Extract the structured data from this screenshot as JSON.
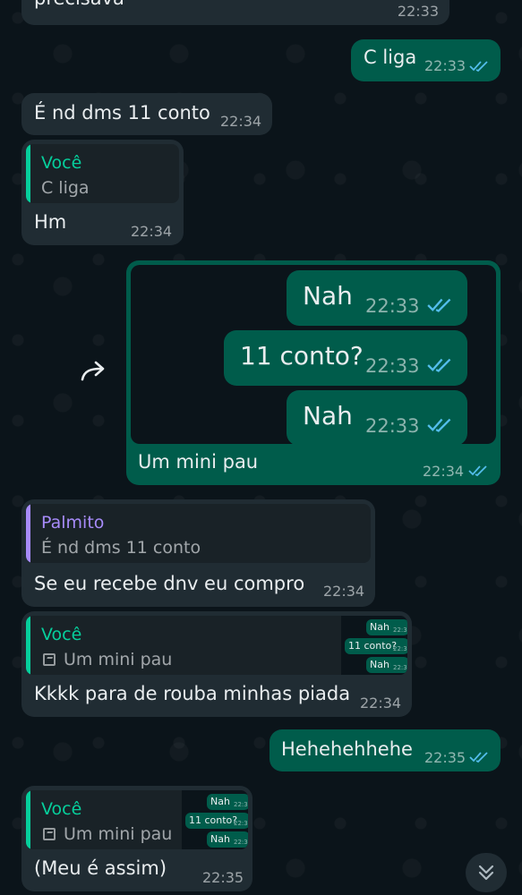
{
  "tick_color": "#53bdeb",
  "messages": {
    "m0": {
      "text": "precisava",
      "time": "22:33"
    },
    "m1": {
      "text": "C liga",
      "time": "22:33"
    },
    "m2": {
      "text": "É nd dms 11 conto",
      "time": "22:34"
    },
    "m3": {
      "quote_author": "Você",
      "quote_text": "C liga",
      "text": "Hm",
      "time": "22:34"
    },
    "m4": {
      "screenshot": [
        {
          "text": "Nah",
          "time": "22:33"
        },
        {
          "text": "11 conto?",
          "time": "22:33"
        },
        {
          "text": "Nah",
          "time": "22:33"
        }
      ],
      "caption": "Um mini pau",
      "time": "22:34",
      "forward_icon": "forward-arrow-icon"
    },
    "m5": {
      "quote_author": "Palmito",
      "quote_text": "É nd dms 11 conto",
      "text": "Se eu recebe dnv eu compro",
      "time": "22:34"
    },
    "m6": {
      "quote_author": "Você",
      "quote_text": "Um mini pau",
      "thumb": [
        {
          "text": "Nah",
          "time": "22:33"
        },
        {
          "text": "11 conto?",
          "time": "22:33"
        },
        {
          "text": "Nah",
          "time": "22:33"
        }
      ],
      "text": "Kkkk para de rouba minhas piada",
      "time": "22:34"
    },
    "m7": {
      "text": "Hehehehhehe",
      "time": "22:35"
    },
    "m8": {
      "quote_author": "Você",
      "quote_text": "Um mini pau",
      "thumb": [
        {
          "text": "Nah",
          "time": "22:33"
        },
        {
          "text": "11 conto?",
          "time": "22:33"
        },
        {
          "text": "Nah",
          "time": "22:33"
        }
      ],
      "text": "(Meu é assim)",
      "time": "22:35"
    }
  },
  "scroll_button_icon": "double-chevron-down-icon"
}
